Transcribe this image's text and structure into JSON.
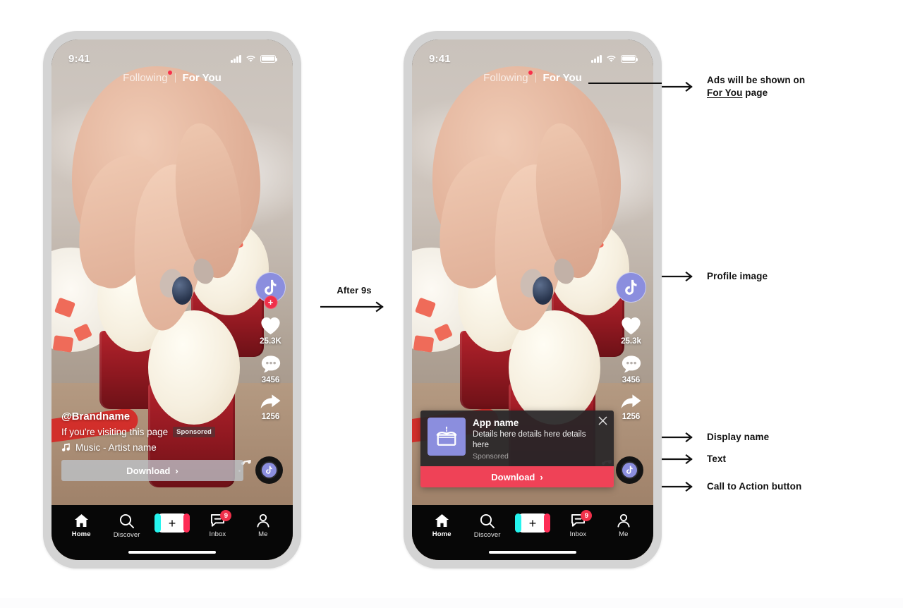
{
  "phones": [
    {
      "id": "phone-before",
      "status_bar": {
        "time": "9:41"
      },
      "top_tabs": {
        "inactive": "Following",
        "active": "For You"
      },
      "rail": {
        "like_count": "25.3K",
        "comment_count": "3456",
        "share_count": "1256",
        "follow_badge": "+"
      },
      "caption": {
        "handle": "@Brandname",
        "description": "If you're visiting this page",
        "sponsored": "Sponsored",
        "music": "Music - Artist name",
        "cta_label": "Download",
        "cta_chevron": "›"
      },
      "bottom_nav": {
        "items": [
          {
            "label": "Home",
            "icon": "home-icon"
          },
          {
            "label": "Discover",
            "icon": "search-icon"
          },
          {
            "label": "",
            "icon": "create-plus-icon"
          },
          {
            "label": "Inbox",
            "icon": "inbox-icon",
            "badge": "9"
          },
          {
            "label": "Me",
            "icon": "person-icon"
          }
        ],
        "create_label": "+"
      }
    },
    {
      "id": "phone-after",
      "status_bar": {
        "time": "9:41"
      },
      "top_tabs": {
        "inactive": "Following",
        "active": "For You"
      },
      "rail": {
        "like_count": "25.3k",
        "comment_count": "3456",
        "share_count": "1256"
      },
      "ad_card": {
        "app_name": "App name",
        "details": "Details here details here details here",
        "sponsored": "Sponsored",
        "cta_label": "Download",
        "cta_chevron": "›",
        "close_icon": "close-icon",
        "app_icon": "cake-icon"
      },
      "bottom_nav": {
        "items": [
          {
            "label": "Home",
            "icon": "home-icon"
          },
          {
            "label": "Discover",
            "icon": "search-icon"
          },
          {
            "label": "",
            "icon": "create-plus-icon"
          },
          {
            "label": "Inbox",
            "icon": "inbox-icon",
            "badge": "9"
          },
          {
            "label": "Me",
            "icon": "person-icon"
          }
        ],
        "create_label": "+"
      }
    }
  ],
  "transition": {
    "label": "After 9s"
  },
  "annotations": [
    {
      "id": "anno-for-you",
      "line1_pre": "Ads will be shown on",
      "line2_underlined": "For You",
      "line2_post": " page"
    },
    {
      "id": "anno-profile",
      "text": "Profile image"
    },
    {
      "id": "anno-display-name",
      "text": "Display name"
    },
    {
      "id": "anno-text",
      "text": "Text"
    },
    {
      "id": "anno-cta",
      "text": "Call to Action button"
    }
  ],
  "colors": {
    "accent_red": "#ef4257",
    "brand_purple": "#8b8ede",
    "tiktok_cyan": "#25f4ee",
    "tiktok_pink": "#fe2c55",
    "badge_red": "#f0304a",
    "phone_frame": "#d4d4d4",
    "nav_background": "#070707"
  }
}
